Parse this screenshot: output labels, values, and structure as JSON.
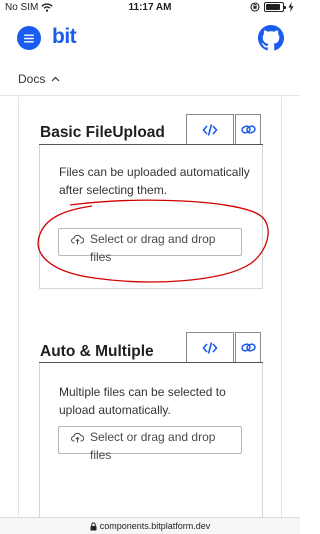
{
  "status_bar": {
    "carrier": "No SIM",
    "time": "11:17 AM",
    "battery_level": 0.85
  },
  "header": {
    "logo": "bit",
    "menu_icon": "hamburger-menu-icon",
    "github_icon": "github-icon",
    "brand_color": "#1a5cf0"
  },
  "docs_bar": {
    "label": "Docs",
    "chevron_icon": "chevron-up-icon"
  },
  "sections": [
    {
      "title": "Basic FileUpload",
      "tabs": [
        {
          "icon": "code-icon",
          "active": true
        },
        {
          "icon": "link-icon",
          "active": false
        }
      ],
      "description": "Files can be uploaded automatically after selecting them.",
      "upload_label": "Select or drag and drop\nfiles",
      "upload_icon": "cloud-upload-icon"
    },
    {
      "title": "Auto & Multiple",
      "tabs": [
        {
          "icon": "code-icon",
          "active": true
        },
        {
          "icon": "link-icon",
          "active": false
        }
      ],
      "description": "Multiple files can be selected to upload automatically.",
      "upload_label": "Select or drag and drop\nfiles",
      "upload_icon": "cloud-upload-icon"
    }
  ],
  "annotation": {
    "color": "#d40000",
    "shape": "freehand-ellipse"
  },
  "url_bar": {
    "url": "components.bitplatform.dev",
    "lock_icon": "lock-icon"
  }
}
